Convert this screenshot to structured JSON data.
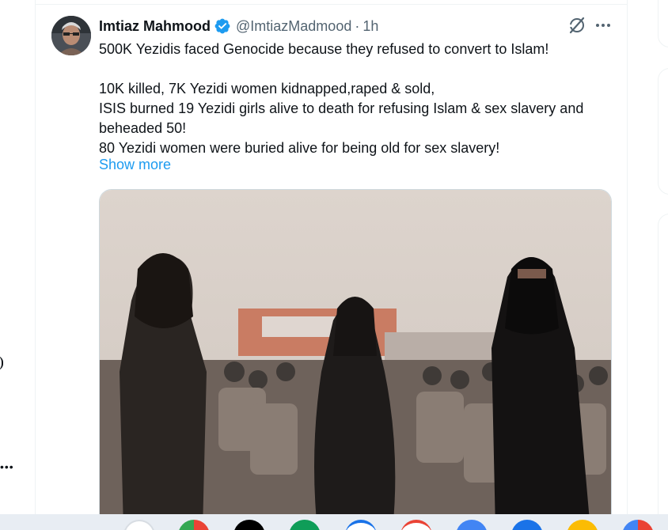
{
  "tweet": {
    "author_name": "Imtiaz Mahmood",
    "handle": "@ImtiazMadmood",
    "separator": "·",
    "time": "1h",
    "lines": [
      "500K Yezidis faced Genocide because they refused to convert to Islam!",
      "",
      "10K killed, 7K Yezidi women kidnapped,raped & sold,",
      "ISIS burned 19 Yezidi girls alive to death for refusing Islam & sex slavery and",
      "beheaded 50!",
      "80 Yezidi women were buried alive for being old for sex slavery!"
    ],
    "show_more": "Show more"
  },
  "left_more": "•••",
  "colors": {
    "accent": "#1d9bf0",
    "text": "#0f1419",
    "muted": "#536471",
    "border": "#eff3f4"
  },
  "icons": {
    "verified": "verified-badge-icon",
    "grok": "grok-icon",
    "more": "more-icon"
  },
  "taskbar": {
    "apps": [
      "launcher",
      "chrome",
      "threads",
      "gmeet",
      "docs",
      "gmail",
      "messages",
      "files",
      "keep",
      "photos"
    ]
  }
}
